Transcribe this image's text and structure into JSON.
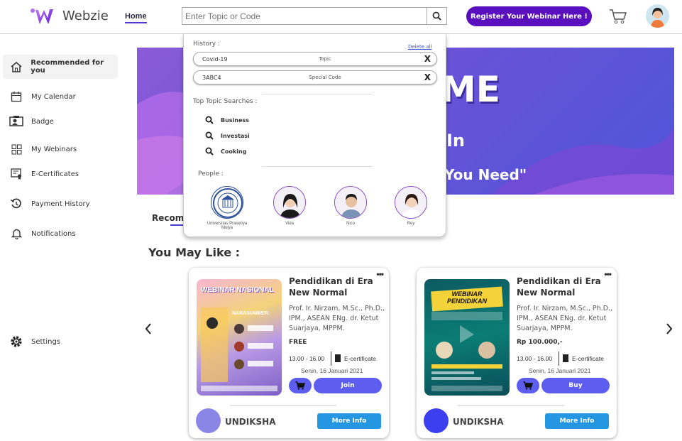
{
  "header": {
    "logo_text": "Webzie",
    "nav_home": "Home",
    "search_placeholder": "Enter Topic or Code",
    "register_label": "Register Your Webinar Here !"
  },
  "sidebar": {
    "items": [
      {
        "label": "Recommended for you",
        "icon": "home-icon"
      },
      {
        "label": "My Calendar",
        "icon": "calendar-icon"
      },
      {
        "label": "Badge",
        "icon": "badge-icon"
      },
      {
        "label": "My Webinars",
        "icon": "grid-icon"
      },
      {
        "label": "E-Certificates",
        "icon": "certificate-icon"
      },
      {
        "label": "Payment History",
        "icon": "history-icon"
      },
      {
        "label": "Notifications",
        "icon": "bell-icon"
      },
      {
        "label": "Settings",
        "icon": "gear-icon"
      }
    ]
  },
  "banner": {
    "line1": "ME",
    "line2": "In",
    "line3": "You Need\""
  },
  "dropdown": {
    "history_label": "History :",
    "delete_all": "Delete all",
    "history": [
      {
        "text": "Covid-19",
        "kind": "Topic"
      },
      {
        "text": "3ABC4",
        "kind": "Special Code"
      }
    ],
    "top_topics_label": "Top Topic Searches :",
    "topics": [
      "Business",
      "Investasi",
      "Cooking"
    ],
    "people_label": "People :",
    "people": [
      {
        "name": "Universitas Prasetiya Mulya"
      },
      {
        "name": "Vida"
      },
      {
        "name": "Nico"
      },
      {
        "name": "Rey"
      }
    ]
  },
  "recommend_tab": "Recomm",
  "you_may_like": "You May Like :",
  "cards": [
    {
      "title": "Pendidikan di Era New Normal",
      "speakers": "Prof. Ir. Nirzam, M.Sc., Ph.D., IPM., ASEAN ENg. dr. Ketut Suarjaya, MPPM.",
      "price": "FREE",
      "time": "13.00 - 16.00",
      "cert": "E-certificate",
      "date": "Senin, 16 Januari 2021",
      "action": "Join",
      "org": "UNDIKSHA",
      "more": "More Info",
      "poster_title": "WEBINAR NASIONAL",
      "poster_sub": "NARASUMBER:",
      "org_color": "#8a86e6"
    },
    {
      "title": "Pendidikan di Era New Normal",
      "speakers": "Prof. Ir. Nirzam, M.Sc., Ph.D., IPM., ASEAN ENg. dr. Ketut Suarjaya, MPPM.",
      "price": "Rp 100.000,-",
      "time": "13.00 - 16.00",
      "cert": "E-certificate",
      "date": "Senin, 16 Januari 2021",
      "action": "Buy",
      "org": "UNDIKSHA",
      "more": "More Info",
      "poster_title": "WEBINAR PENDIDIKAN",
      "org_color": "#3b3ff0"
    }
  ],
  "colors": {
    "accent": "#5a0fbf",
    "button": "#5d5ef0",
    "more_info": "#2596e2"
  }
}
